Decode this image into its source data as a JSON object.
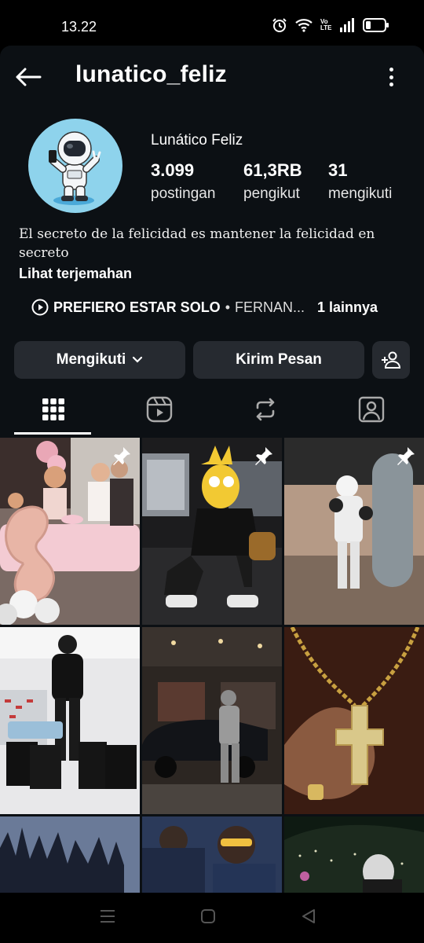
{
  "status_bar": {
    "time": "13.22",
    "icons": [
      "alarm-icon",
      "wifi-icon",
      "volte-icon",
      "signal-icon",
      "battery-icon"
    ],
    "volte_label": "Vo LTE"
  },
  "header": {
    "username": "lunatico_feliz",
    "back_icon": "arrow-left-icon",
    "menu_icon": "more-vertical-icon"
  },
  "profile": {
    "display_name": "Lunático Feliz",
    "stats": [
      {
        "value": "3.099",
        "label": "postingan"
      },
      {
        "value": "61,3RB",
        "label": "pengikut"
      },
      {
        "value": "31",
        "label": "mengikuti"
      }
    ],
    "bio": "El secreto de la felicidad es mantener la felicidad en secreto",
    "translate_link": "Lihat terjemahan",
    "music": {
      "song": "PREFIERO ESTAR SOLO",
      "separator": "•",
      "artist": "FERNAN...",
      "more": "1 lainnya"
    }
  },
  "actions": {
    "following_label": "Mengikuti",
    "message_label": "Kirim Pesan"
  },
  "tabs": [
    {
      "name": "posts",
      "icon": "grid-icon",
      "active": true
    },
    {
      "name": "reels",
      "icon": "reels-icon",
      "active": false
    },
    {
      "name": "reposts",
      "icon": "repost-icon",
      "active": false
    },
    {
      "name": "tagged",
      "icon": "tagged-person-icon",
      "active": false
    }
  ],
  "posts": [
    {
      "subject": "birthday party with pink balloons",
      "pinned": true
    },
    {
      "subject": "cartoon character in car with phone",
      "pinned": true
    },
    {
      "subject": "child boxing at punching bag",
      "pinned": true
    },
    {
      "subject": "man in sneaker store with shopping bags",
      "pinned": false
    },
    {
      "subject": "man beside car in parking garage",
      "pinned": false
    },
    {
      "subject": "hand holding gold cross chain",
      "pinned": false
    },
    {
      "subject": "trees against sky",
      "pinned": false
    },
    {
      "subject": "group portrait with sunglasses",
      "pinned": false
    },
    {
      "subject": "night city view",
      "pinned": false
    }
  ],
  "colors": {
    "background": "#0c1014",
    "button": "#262a30",
    "avatar_bg": "#8ed3ec"
  }
}
